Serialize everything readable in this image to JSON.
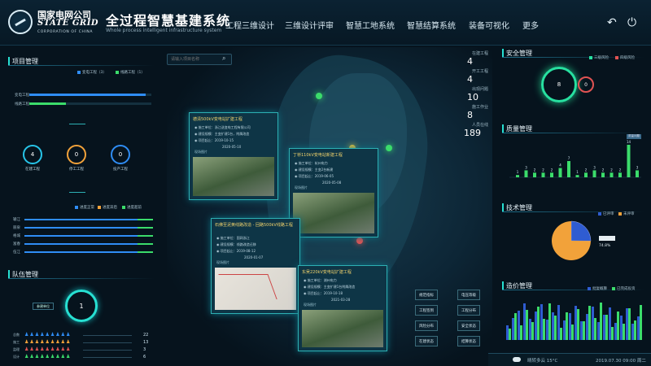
{
  "header": {
    "logo_cn": "国家电网公司",
    "logo_en": "STATE GRID",
    "logo_sub": "CORPORATION OF CHINA",
    "title": "全过程智慧基建系统",
    "subtitle": "Whole process intelligent infrastructure system",
    "nav": [
      "工程三维设计",
      "三维设计评审",
      "智慧工地系统",
      "智慧结算系统",
      "装备可视化",
      "更多"
    ],
    "back_icon": "back-icon",
    "power_icon": "power-icon"
  },
  "search": {
    "placeholder": "请输入项目名称"
  },
  "project_mgmt": {
    "title": "项目管理",
    "legend": [
      {
        "label": "变电工程（3）",
        "color": "#2f8df5"
      },
      {
        "label": "线路工程（1）",
        "color": "#3bdc6b"
      }
    ],
    "bars": [
      {
        "label": "变电工程",
        "value": 3,
        "fill": 0.95,
        "color": "#2f8df5"
      },
      {
        "label": "线路工程",
        "value": 1,
        "fill": 0.3,
        "color": "#3bdc6b"
      }
    ],
    "rings": [
      {
        "value": "4",
        "label": "在建工程",
        "color": "#27c4e8"
      },
      {
        "value": "0",
        "label": "停工工程",
        "color": "#f2a23a"
      },
      {
        "value": "0",
        "label": "投产工程",
        "color": "#2f8df5"
      }
    ],
    "progress_legend": [
      {
        "label": "进度正常",
        "color": "#2f8df5"
      },
      {
        "label": "进度滞后",
        "color": "#f2a23a"
      },
      {
        "label": "进度超前",
        "color": "#3bdc6b"
      }
    ],
    "progress_rows": [
      "输江",
      "丽泉",
      "格城",
      "富春",
      "伍江"
    ]
  },
  "team_mgmt": {
    "title": "队伍管理",
    "total": "1",
    "tag": "参建单位",
    "rows": [
      {
        "value": "22",
        "color": "#2f8df5"
      },
      {
        "value": "13",
        "color": "#f2a23a"
      },
      {
        "value": "3",
        "color": "#e05353"
      },
      {
        "value": "6",
        "color": "#3bdc6b"
      }
    ],
    "row_labels": [
      "总数",
      "施工",
      "监理",
      "设计"
    ]
  },
  "map_stats": [
    {
      "label": "在建工程",
      "value": "4"
    },
    {
      "label": "开工工程",
      "value": "4"
    },
    {
      "label": "出现问题",
      "value": "10"
    },
    {
      "label": "施工作业",
      "value": "8"
    },
    {
      "label": "人员在线",
      "value": "189"
    }
  ],
  "cards": [
    {
      "title": "德清500kV变电站扩建工程",
      "lines": [
        "◉ 施工单位：浙江送变电工程有限公司",
        "◉ 建设规模：主变扩建1台，附属改造",
        "◉ 项目起止：2019-10-15"
      ],
      "date": "2020-05-10",
      "img_label": "现场图片"
    },
    {
      "title": "丁桥110kV变电站新建工程",
      "lines": [
        "◉ 施工单位：杭州电力",
        "◉ 建设规模：主变2台新建",
        "◉ 项目起止：2019-06-05"
      ],
      "date": "2020-05-08",
      "img_label": "现场图片"
    },
    {
      "title": "石佛至泥黄线路改造 - 回路500kV线路工程",
      "lines": [
        "◉ 施工单位：国网浙江",
        "◉ 建设规模：线路改造迁移",
        "◉ 项目起止：2019-08-12"
      ],
      "date": "2020-01-07",
      "img_label": "现场图片"
    },
    {
      "title": "东吴220kV变电站扩建工程",
      "lines": [
        "◉ 施工单位：湖州电力",
        "◉ 建设规模：主变扩建1台附属改造",
        "◉ 项目起止：2019-10-18"
      ],
      "date": "2021-03-28",
      "img_label": "现场图片"
    }
  ],
  "map_buttons": {
    "left": [
      "规范指标",
      "工程签到",
      "风险分布",
      "在建状态"
    ],
    "right": [
      "电压等级",
      "工程分布",
      "安全状态",
      "结算状态"
    ]
  },
  "safety_mgmt": {
    "title": "安全管理",
    "legend": [
      {
        "label": "三级风险",
        "color": "#27e0a0"
      },
      {
        "label": "四级风险",
        "color": "#e05353"
      }
    ],
    "green": "8",
    "red": "0"
  },
  "quality_mgmt": {
    "title": "质量管理",
    "legend": "质量问题",
    "values": [
      1,
      3,
      2,
      2,
      2,
      4,
      7,
      1,
      2,
      3,
      2,
      2,
      2,
      14,
      3
    ]
  },
  "tech_mgmt": {
    "title": "技术管理",
    "legend": [
      {
        "label": "已评审",
        "color": "#2f5cd1"
      },
      {
        "label": "未评审",
        "color": "#f2a23a"
      }
    ],
    "label": "74.8%",
    "slices": [
      0.252,
      0.748
    ]
  },
  "cost_mgmt": {
    "title": "造价管理",
    "legend": [
      {
        "label": "批复概算",
        "color": "#2f5cd1"
      },
      {
        "label": "已完成投资",
        "color": "#3bdc6b"
      }
    ]
  },
  "status": {
    "weather": "晴转多云  15°C",
    "datetime": "2019.07.30  09:00  周二"
  }
}
